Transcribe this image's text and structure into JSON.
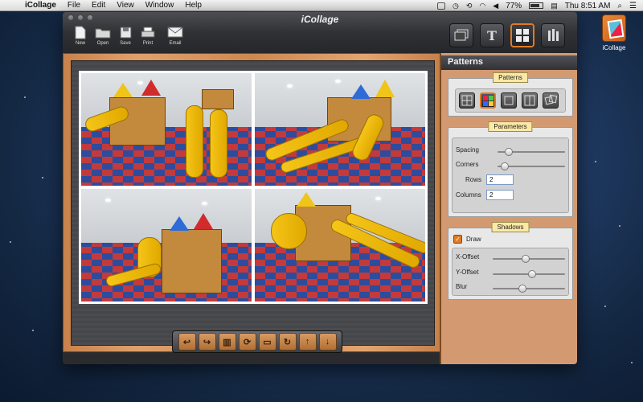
{
  "menubar": {
    "apple": "",
    "app_name": "iCollage",
    "menus": [
      "File",
      "Edit",
      "View",
      "Window",
      "Help"
    ],
    "battery": "77%",
    "clock": "Thu 8:51 AM"
  },
  "window": {
    "title": "iCollage",
    "toolbar": {
      "new": "New",
      "open": "Open",
      "save": "Save",
      "print": "Print",
      "email": "Email"
    }
  },
  "panel": {
    "header": "Patterns",
    "patterns_label": "Patterns",
    "parameters_label": "Parameters",
    "spacing_label": "Spacing",
    "spacing_value": 0.12,
    "corners_label": "Corners",
    "corners_value": 0.05,
    "rows_label": "Rows",
    "rows_value": "2",
    "columns_label": "Columns",
    "columns_value": "2",
    "shadows_label": "Shadows",
    "draw_label": "Draw",
    "draw_checked": true,
    "xoffset_label": "X-Offset",
    "xoffset_value": 0.45,
    "yoffset_label": "Y-Offset",
    "yoffset_value": 0.55,
    "blur_label": "Blur",
    "blur_value": 0.4
  },
  "dock": {
    "app_label": "iCollage"
  },
  "colors": {
    "accent": "#e07a24",
    "wood": "#d39a72"
  }
}
